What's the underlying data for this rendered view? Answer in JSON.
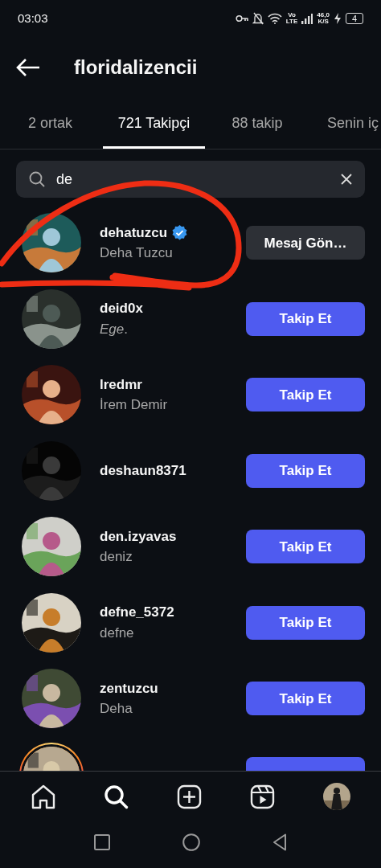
{
  "status_bar": {
    "time": "03:03",
    "volte_top": "Vo",
    "volte_bottom": "LTE",
    "speed_value": "46,0",
    "speed_unit": "K/S",
    "battery": "4"
  },
  "header": {
    "title": "floridalizencii"
  },
  "tabs": [
    {
      "label": "2 ortak",
      "selected": false
    },
    {
      "label": "721 Takipçi",
      "selected": true
    },
    {
      "label": "88 takip",
      "selected": false
    },
    {
      "label": "Senin iç",
      "selected": false
    }
  ],
  "search": {
    "value": "de"
  },
  "rows": [
    {
      "username": "dehatuzcu",
      "name": "Deha Tuzcu",
      "verified": true,
      "story_ring": false,
      "button": {
        "kind": "message",
        "label": "Mesaj Gön…"
      }
    },
    {
      "username": "deid0x",
      "name": "*Ege*.",
      "verified": false,
      "story_ring": false,
      "button": {
        "kind": "follow",
        "label": "Takip Et"
      }
    },
    {
      "username": "lredmr",
      "name": "İrem Demir",
      "verified": false,
      "story_ring": false,
      "button": {
        "kind": "follow",
        "label": "Takip Et"
      }
    },
    {
      "username": "deshaun8371",
      "verified": false,
      "story_ring": false,
      "button": {
        "kind": "follow",
        "label": "Takip Et"
      }
    },
    {
      "username": "den.izyavas",
      "name": "deniz",
      "verified": false,
      "story_ring": false,
      "button": {
        "kind": "follow",
        "label": "Takip Et"
      }
    },
    {
      "username": "defne_5372",
      "name": "defne",
      "verified": false,
      "story_ring": false,
      "button": {
        "kind": "follow",
        "label": "Takip Et"
      }
    },
    {
      "username": "zentuzcu",
      "name": "Deha",
      "verified": false,
      "story_ring": false,
      "button": {
        "kind": "follow",
        "label": "Takip Et"
      }
    },
    {
      "verified": false,
      "story_ring": true,
      "button": {
        "kind": "follow"
      }
    }
  ],
  "bottom_nav": [
    {
      "kind": "home",
      "selected": false
    },
    {
      "kind": "search",
      "selected": true
    },
    {
      "kind": "create",
      "selected": false
    },
    {
      "kind": "reels",
      "selected": false
    },
    {
      "kind": "profile",
      "selected": false
    }
  ],
  "annotation": {
    "color": "#ee2d14"
  }
}
